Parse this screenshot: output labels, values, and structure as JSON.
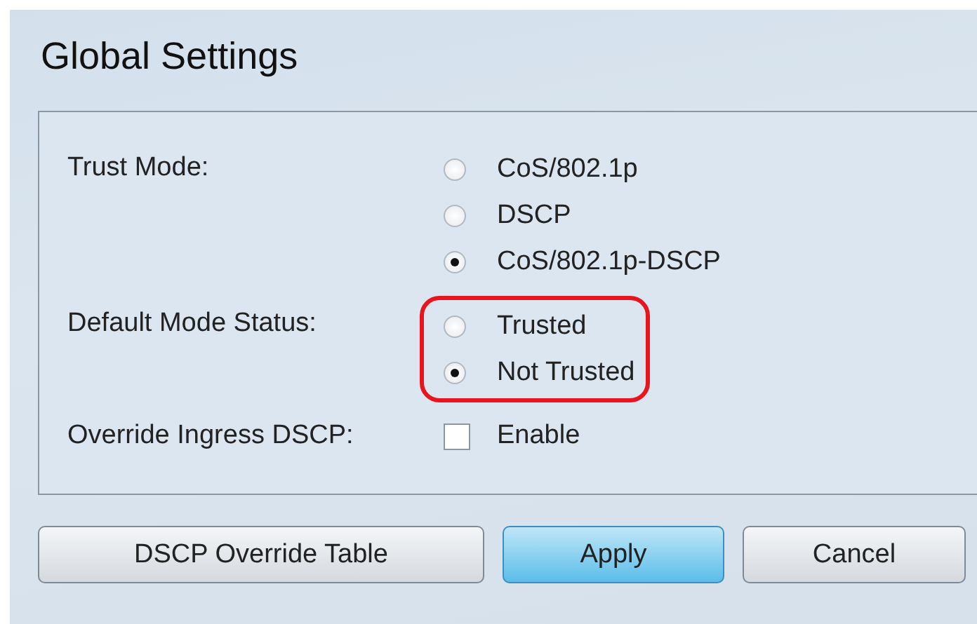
{
  "title": "Global Settings",
  "fields": [
    {
      "label": "Trust Mode:",
      "kind": "radio",
      "highlighted": false,
      "options": [
        {
          "label": "CoS/802.1p",
          "selected": false
        },
        {
          "label": "DSCP",
          "selected": false
        },
        {
          "label": "CoS/802.1p-DSCP",
          "selected": true
        }
      ]
    },
    {
      "label": "Default Mode Status:",
      "kind": "radio",
      "highlighted": true,
      "options": [
        {
          "label": "Trusted",
          "selected": false
        },
        {
          "label": "Not Trusted",
          "selected": true
        }
      ]
    },
    {
      "label": "Override Ingress DSCP:",
      "kind": "checkbox",
      "option": "Enable",
      "checked": false
    }
  ],
  "buttons": [
    {
      "label": "DSCP Override Table",
      "primary": false
    },
    {
      "label": "Apply",
      "primary": true
    },
    {
      "label": "Cancel",
      "primary": false
    }
  ]
}
